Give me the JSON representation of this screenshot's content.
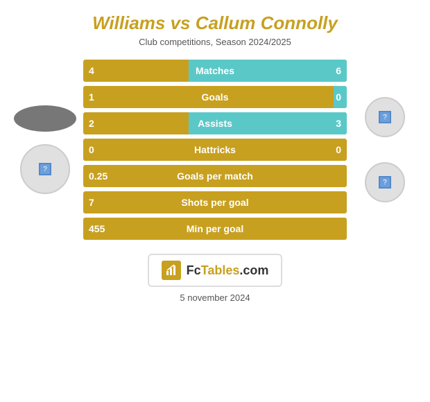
{
  "header": {
    "title": "Williams vs Callum Connolly",
    "subtitle": "Club competitions, Season 2024/2025"
  },
  "stats": [
    {
      "label": "Matches",
      "left": "4",
      "right": "6",
      "has_cyan": true,
      "cyan_pct": 60
    },
    {
      "label": "Goals",
      "left": "1",
      "right": "0",
      "has_cyan": true,
      "cyan_pct": 5
    },
    {
      "label": "Assists",
      "left": "2",
      "right": "3",
      "has_cyan": true,
      "cyan_pct": 60
    },
    {
      "label": "Hattricks",
      "left": "0",
      "right": "0",
      "has_cyan": false,
      "cyan_pct": 0
    },
    {
      "label": "Goals per match",
      "left": "0.25",
      "right": "",
      "has_cyan": false,
      "cyan_pct": 0
    },
    {
      "label": "Shots per goal",
      "left": "7",
      "right": "",
      "has_cyan": false,
      "cyan_pct": 0
    },
    {
      "label": "Min per goal",
      "left": "455",
      "right": "",
      "has_cyan": false,
      "cyan_pct": 0
    }
  ],
  "logo": {
    "text": "FcTables.com"
  },
  "date": "5 november 2024"
}
